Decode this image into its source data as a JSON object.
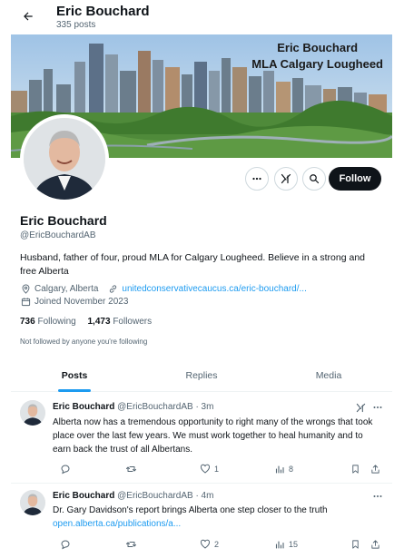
{
  "header": {
    "name": "Eric Bouchard",
    "post_count": "335 posts"
  },
  "banner": {
    "line1": "Eric Bouchard",
    "line2": "MLA Calgary Lougheed"
  },
  "profile": {
    "name": "Eric Bouchard",
    "handle": "@EricBouchardAB",
    "bio": "Husband, father of four, proud MLA for Calgary Lougheed. Believe in a strong and free Alberta",
    "location": "Calgary, Alberta",
    "website": "unitedconservativecaucus.ca/eric-bouchard/...",
    "joined": "Joined November 2023",
    "following_count": "736",
    "following_label": "Following",
    "followers_count": "1,473",
    "followers_label": "Followers",
    "not_followed_text": "Not followed by anyone you're following",
    "follow_button": "Follow"
  },
  "tabs": [
    {
      "label": "Posts",
      "active": true
    },
    {
      "label": "Replies",
      "active": false
    },
    {
      "label": "Media",
      "active": false
    }
  ],
  "tweets": [
    {
      "name": "Eric Bouchard",
      "handle": "@EricBouchardAB",
      "time": "· 3m",
      "text": "Alberta now has a tremendous opportunity to right many of the wrongs that took place over the last few years. We must work together to heal humanity and to earn back the trust of all Albertans.",
      "link": "",
      "replies": "",
      "reposts": "",
      "likes": "1",
      "views": "8"
    },
    {
      "name": "Eric Bouchard",
      "handle": "@EricBouchardAB",
      "time": "· 4m",
      "text": "Dr. Gary Davidson's report brings Alberta one step closer to the truth",
      "link": "open.alberta.ca/publications/a...",
      "replies": "",
      "reposts": "",
      "likes": "2",
      "views": "15"
    }
  ],
  "icons": {
    "back": "arrow-left-icon",
    "more": "more-horizontal-icon",
    "grok": "grok-icon",
    "search": "search-icon",
    "location": "location-pin-icon",
    "link": "link-icon",
    "calendar": "calendar-icon",
    "reply": "reply-icon",
    "repost": "repost-icon",
    "like": "heart-icon",
    "views": "views-icon",
    "bookmark": "bookmark-icon",
    "share": "share-icon"
  },
  "colors": {
    "accent": "#1d9bf0",
    "text": "#0f1419",
    "muted": "#536471",
    "follow_bg": "#0f1419"
  }
}
